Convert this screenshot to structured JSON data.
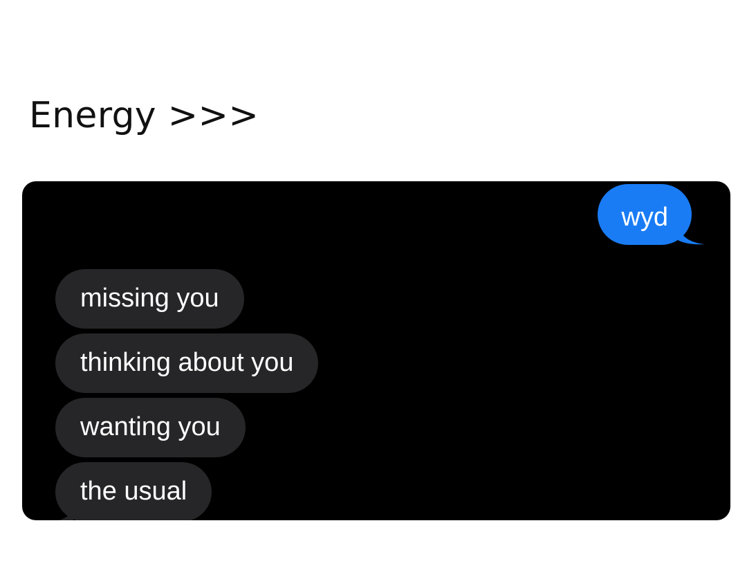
{
  "post": {
    "caption": "Energy >>>"
  },
  "chat": {
    "sent_messages": [
      "wyd"
    ],
    "received_messages": [
      "missing you",
      "thinking about you",
      "wanting you",
      "the usual"
    ]
  },
  "colors": {
    "sent_bubble": "#1a7cf5",
    "received_bubble": "#262628",
    "chat_background": "#000000",
    "page_background": "#ffffff"
  }
}
